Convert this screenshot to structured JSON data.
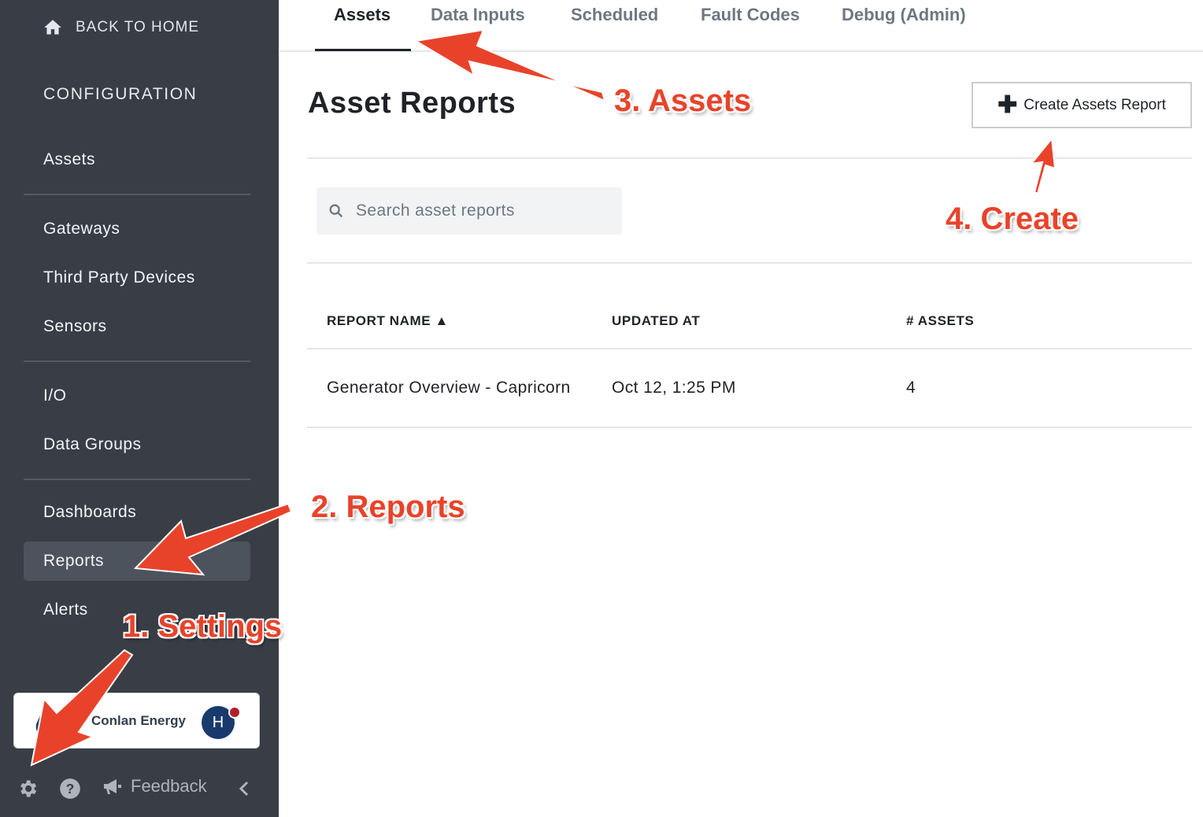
{
  "sidebar": {
    "back_home_label": "BACK TO HOME",
    "section_title": "CONFIGURATION",
    "items": [
      {
        "label": "Assets"
      },
      {
        "label": "Gateways"
      },
      {
        "label": "Third Party Devices"
      },
      {
        "label": "Sensors"
      },
      {
        "label": "I/O"
      },
      {
        "label": "Data Groups"
      },
      {
        "label": "Dashboards"
      },
      {
        "label": "Reports",
        "active": true
      },
      {
        "label": "Alerts"
      }
    ],
    "org": {
      "name": "Conlan Energy",
      "avatar_initial": "H"
    },
    "feedback_label": "Feedback",
    "icons": [
      "home-icon",
      "gear-icon",
      "help-icon",
      "megaphone-icon",
      "chevron-left-icon"
    ]
  },
  "tabs": [
    {
      "label": "Assets",
      "active": true
    },
    {
      "label": "Data Inputs"
    },
    {
      "label": "Scheduled"
    },
    {
      "label": "Fault Codes"
    },
    {
      "label": "Debug (Admin)"
    }
  ],
  "main": {
    "title": "Asset Reports",
    "create_button_label": "Create Assets Report",
    "search_placeholder": "Search asset reports",
    "table": {
      "columns": [
        "REPORT NAME ▲",
        "UPDATED AT",
        "# ASSETS"
      ],
      "rows": [
        {
          "name": "Generator Overview - Capricorn",
          "updated_at": "Oct 12, 1:25 PM",
          "assets": "4"
        }
      ]
    }
  },
  "annotations": {
    "step1": "1. Settings",
    "step2": "2. Reports",
    "step3": "3. Assets",
    "step4": "4. Create",
    "color": "#e8432a"
  },
  "colors": {
    "sidebar_bg": "#393e46",
    "active_item_bg": "#4d535c",
    "avatar_bg": "#183a6d",
    "notification_dot": "#b01e2c"
  }
}
